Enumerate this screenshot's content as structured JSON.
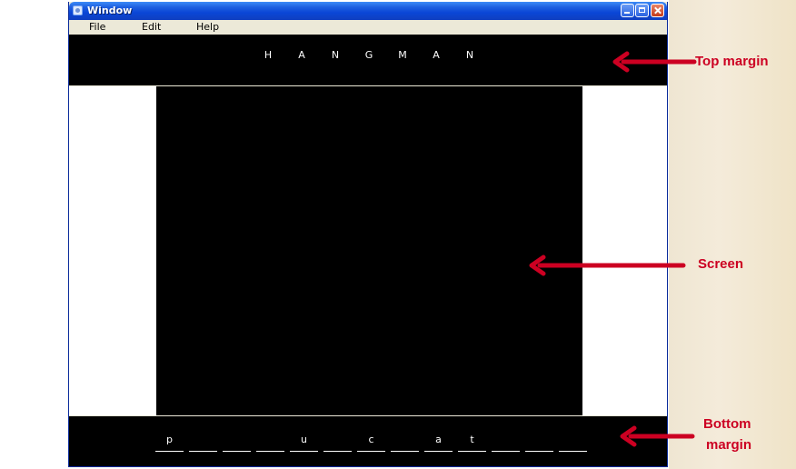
{
  "window": {
    "title": "Window"
  },
  "menu": {
    "file": "File",
    "edit": "Edit",
    "help": "Help"
  },
  "game": {
    "title_letters": [
      "H",
      "A",
      "N",
      "G",
      "M",
      "A",
      "N"
    ],
    "word_slots": [
      "p",
      "",
      "",
      "",
      "u",
      "",
      "c",
      "",
      "a",
      "t",
      "",
      "",
      ""
    ]
  },
  "annotations": {
    "top_margin": "Top margin",
    "screen": "Screen",
    "bottom_margin_line1": "Bottom",
    "bottom_margin_line2": "margin"
  },
  "colors": {
    "annotation": "#cc0022",
    "titlebar": "#0a46d6",
    "canvas": "#000000"
  }
}
